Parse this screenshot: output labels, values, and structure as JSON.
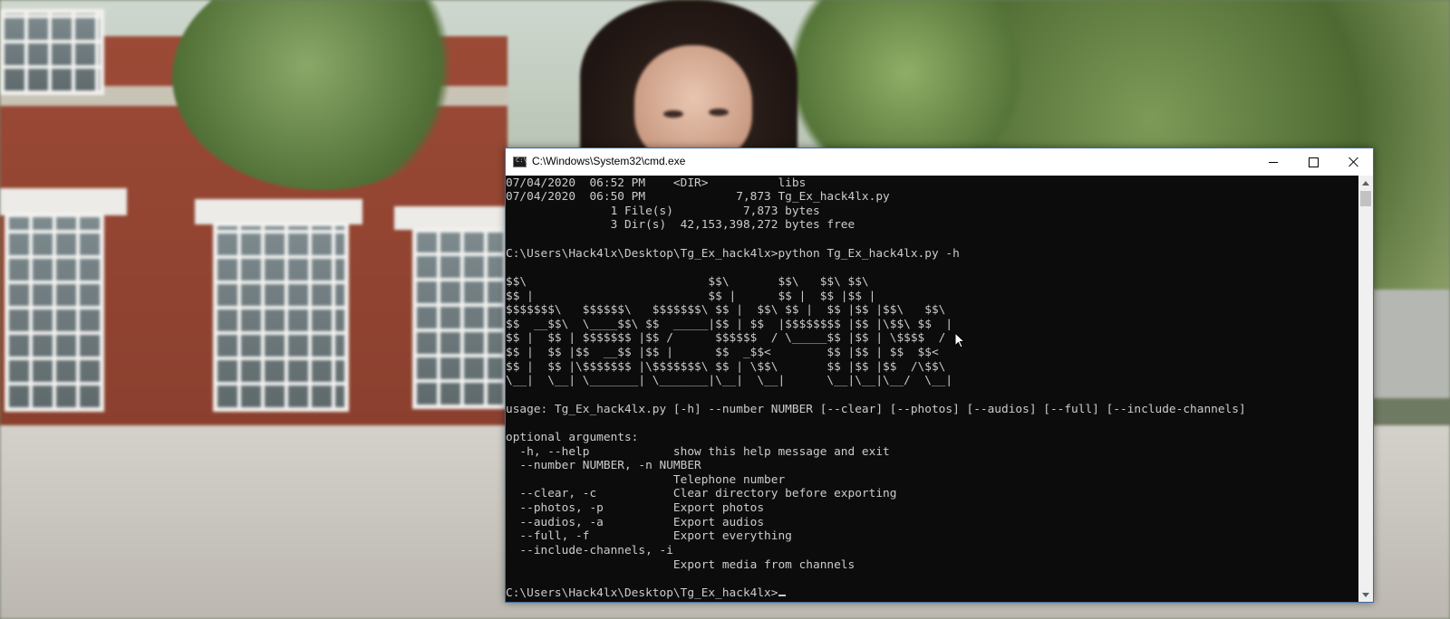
{
  "window": {
    "title": "C:\\Windows\\System32\\cmd.exe",
    "app_icon_glyph": "C:\\",
    "icons": [
      "console-app-icon",
      "minimize-icon",
      "maximize-icon",
      "close-icon"
    ]
  },
  "console": {
    "lines": [
      "07/04/2020  06:52 PM    <DIR>          libs",
      "07/04/2020  06:50 PM             7,873 Tg_Ex_hack4lx.py",
      "               1 File(s)          7,873 bytes",
      "               3 Dir(s)  42,153,398,272 bytes free",
      "",
      "C:\\Users\\Hack4lx\\Desktop\\Tg_Ex_hack4lx>python Tg_Ex_hack4lx.py -h",
      "",
      "$$\\                          $$\\       $$\\   $$\\ $$\\",
      "$$ |                         $$ |      $$ |  $$ |$$ |",
      "$$$$$$$\\   $$$$$$\\   $$$$$$$\\ $$ |  $$\\ $$ |  $$ |$$ |$$\\   $$\\",
      "$$  __$$\\  \\____$$\\ $$  _____|$$ | $$  |$$$$$$$$ |$$ |\\$$\\ $$  |",
      "$$ |  $$ | $$$$$$$ |$$ /      $$$$$$  / \\_____$$ |$$ | \\$$$$  /",
      "$$ |  $$ |$$  __$$ |$$ |      $$  _$$<        $$ |$$ | $$  $$<",
      "$$ |  $$ |\\$$$$$$$ |\\$$$$$$$\\ $$ | \\$$\\       $$ |$$ |$$  /\\$$\\",
      "\\__|  \\__| \\_______| \\_______|\\__|  \\__|      \\__|\\__|\\__/  \\__|",
      "",
      "usage: Tg_Ex_hack4lx.py [-h] --number NUMBER [--clear] [--photos] [--audios] [--full] [--include-channels]",
      "",
      "optional arguments:",
      "  -h, --help            show this help message and exit",
      "  --number NUMBER, -n NUMBER",
      "                        Telephone number",
      "  --clear, -c           Clear directory before exporting",
      "  --photos, -p          Export photos",
      "  --audios, -a          Export audios",
      "  --full, -f            Export everything",
      "  --include-channels, -i",
      "                        Export media from channels",
      "",
      "C:\\Users\\Hack4lx\\Desktop\\Tg_Ex_hack4lx>"
    ]
  },
  "colors": {
    "console_background": "#0c0c0c",
    "console_text": "#cccccc",
    "titlebar_background": "#ffffff",
    "window_border": "#3a6ea5"
  }
}
